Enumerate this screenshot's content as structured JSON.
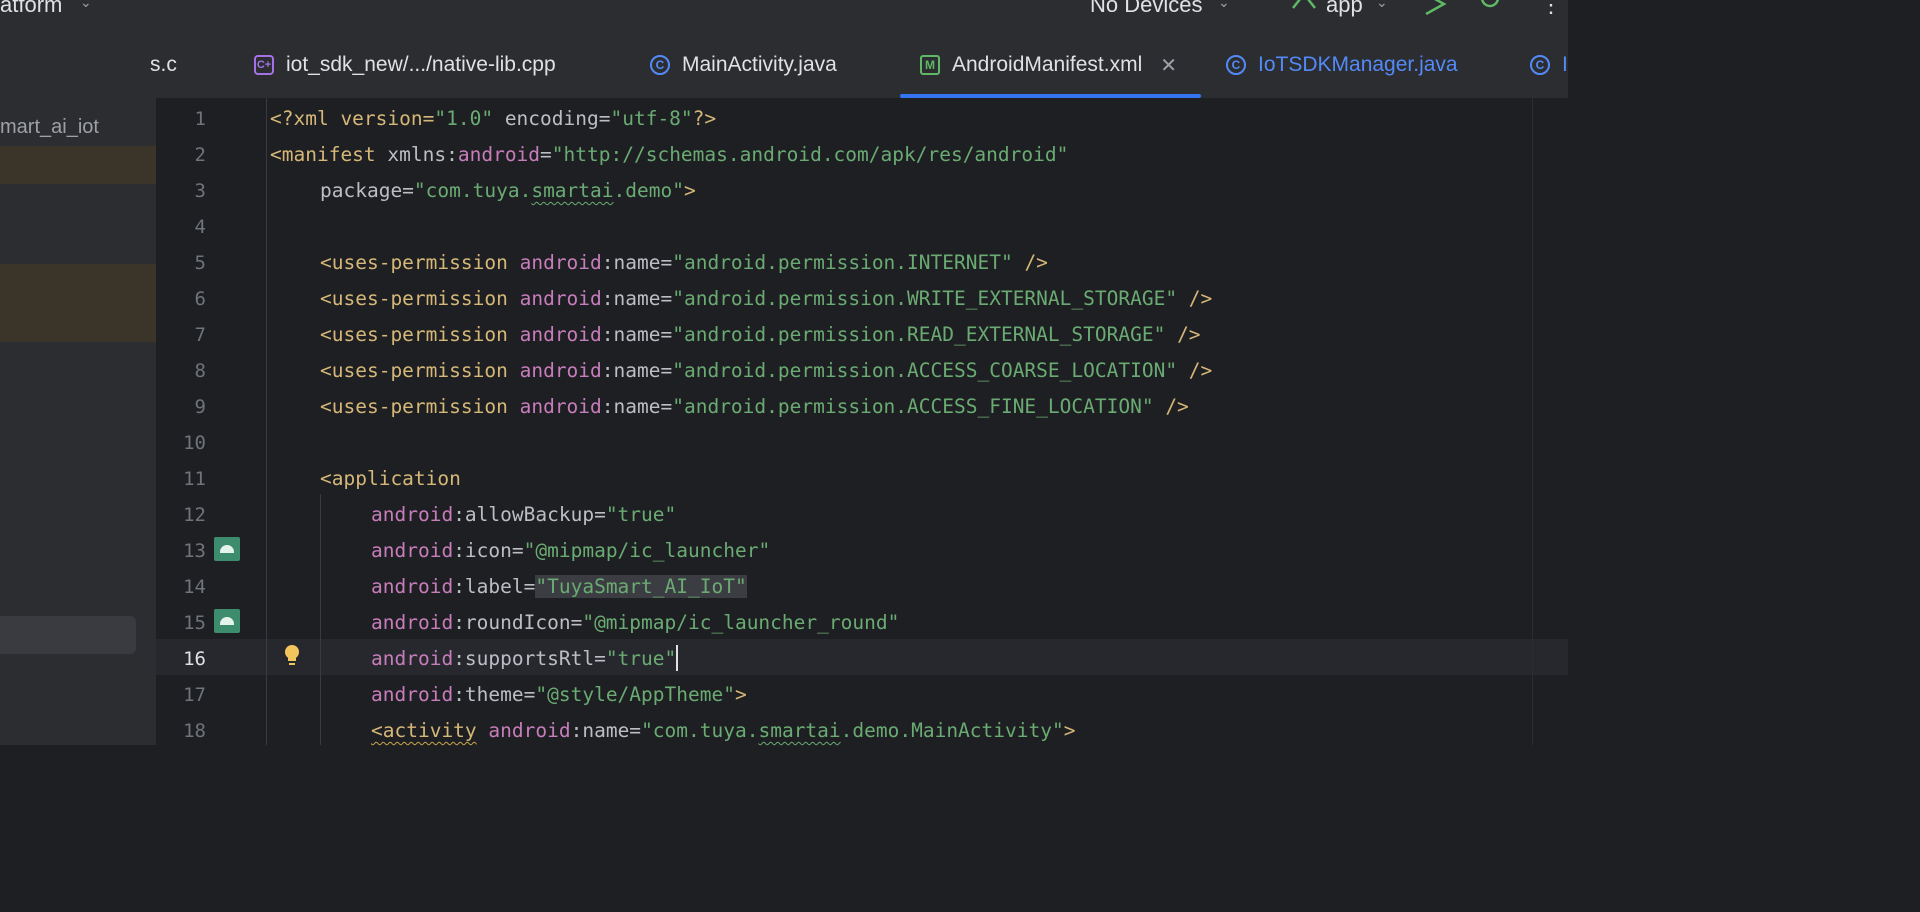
{
  "toolbar": {
    "project_label": "atform",
    "devices_label": "No Devices",
    "config_label": "app"
  },
  "sidebar": {
    "visible_text": "mart_ai_iot"
  },
  "tabs": [
    {
      "label": "s.c",
      "icon": "c-file-icon"
    },
    {
      "label": "iot_sdk_new/.../native-lib.cpp",
      "icon": "cpp-file-icon"
    },
    {
      "label": "MainActivity.java",
      "icon": "java-class-icon"
    },
    {
      "label": "AndroidManifest.xml",
      "icon": "manifest-icon",
      "active": true
    },
    {
      "label": "IoTSDKManager.java",
      "icon": "java-class-icon"
    },
    {
      "label": "I",
      "icon": "java-class-icon"
    }
  ],
  "tab_markers": {
    "java": "C",
    "cpp": "C+",
    "manifest": "M"
  },
  "editor": {
    "current_line": 16,
    "line_numbers": [
      "1",
      "2",
      "3",
      "4",
      "5",
      "6",
      "7",
      "8",
      "9",
      "10",
      "11",
      "12",
      "13",
      "14",
      "15",
      "16",
      "17",
      "18"
    ],
    "lines": {
      "l1": {
        "a": "<?xml version=",
        "b": "\"1.0\"",
        "c": " encoding=",
        "d": "\"utf-8\"",
        "e": "?>"
      },
      "l2": {
        "a": "<manifest",
        "b": " xmlns:",
        "c": "android",
        "d": "=",
        "e": "\"http://schemas.android.com/apk/res/android\""
      },
      "l3": {
        "a": "package=",
        "b": "\"com.tuya.",
        "c": "smartai",
        "d": ".demo\"",
        "e": ">"
      },
      "l5": {
        "tag": "<uses-permission",
        "ns": "android",
        "attr": ":name=",
        "val": "\"android.permission.INTERNET\"",
        "end": " />"
      },
      "l6": {
        "tag": "<uses-permission",
        "ns": "android",
        "attr": ":name=",
        "val": "\"android.permission.WRITE_EXTERNAL_STORAGE\"",
        "end": " />"
      },
      "l7": {
        "tag": "<uses-permission",
        "ns": "android",
        "attr": ":name=",
        "val": "\"android.permission.READ_EXTERNAL_STORAGE\"",
        "end": " />"
      },
      "l8": {
        "tag": "<uses-permission",
        "ns": "android",
        "attr": ":name=",
        "val": "\"android.permission.ACCESS_COARSE_LOCATION\"",
        "end": " />"
      },
      "l9": {
        "tag": "<uses-permission",
        "ns": "android",
        "attr": ":name=",
        "val": "\"android.permission.ACCESS_FINE_LOCATION\"",
        "end": " />"
      },
      "l11": {
        "tag": "<application"
      },
      "l12": {
        "ns": "android",
        "attr": ":allowBackup=",
        "val": "\"true\""
      },
      "l13": {
        "ns": "android",
        "attr": ":icon=",
        "val": "\"@mipmap/ic_launcher\""
      },
      "l14": {
        "ns": "android",
        "attr": ":label=",
        "val": "\"TuyaSmart_AI_IoT\""
      },
      "l15": {
        "ns": "android",
        "attr": ":roundIcon=",
        "val": "\"@mipmap/ic_launcher_round\""
      },
      "l16": {
        "ns": "android",
        "attr": ":supportsRtl=",
        "val": "\"true\""
      },
      "l17": {
        "ns": "android",
        "attr": ":theme=",
        "val": "\"@style/AppTheme\"",
        "end": ">"
      },
      "l18": {
        "tag": "<activity",
        "ns": "android",
        "attr": ":name=",
        "val1": "\"com.tuya.",
        "val2": "smartai",
        "val3": ".demo.MainActivity\"",
        "end": ">"
      }
    }
  },
  "colors": {
    "tag": "#d5b778",
    "namespace": "#c77dbb",
    "string": "#6aab73",
    "accent": "#3574f0"
  }
}
